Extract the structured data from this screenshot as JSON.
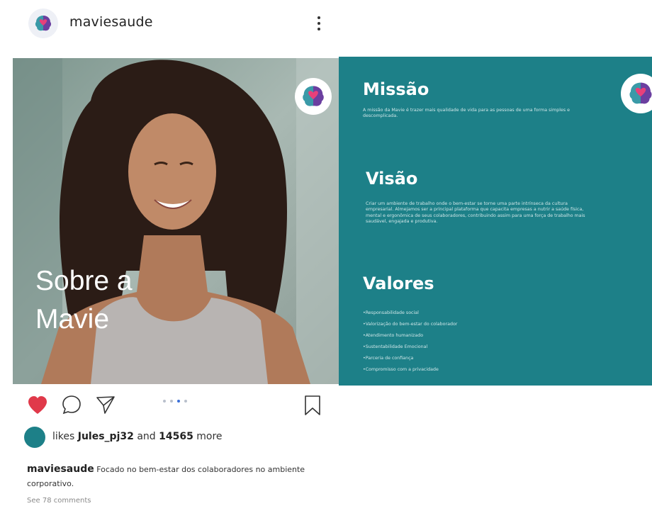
{
  "post": {
    "username": "maviesaude",
    "slide_photo": {
      "title_line1": "Sobre a",
      "title_line2": "Mavie"
    },
    "slide_info": {
      "mission_title": "Missão",
      "mission_text": "A missão da Mavie é trazer mais qualidade de vida para as pessoas de uma forma simples e descomplicada.",
      "vision_title": "Visão",
      "vision_text": "Criar um ambiente de trabalho onde o bem-estar se torne uma parte intrínseca da cultura empresarial. Almejamos ser a principal plataforma que capacita empresas a nutrir a saúde física, mental e ergonômica de seus colaboradores, contribuindo assim para uma força de trabalho mais saudável, engajada e produtiva.",
      "values_title": "Valores",
      "values": [
        "•Responsabilidade social",
        "•Valorização do bem-estar do colaborador",
        "•Atendimento humanizado",
        "•Sustentabilidade Emocional",
        "•Parceria de confiança",
        "•Compromisso com a privacidade"
      ]
    },
    "likes": {
      "prefix": "likes",
      "user": "Jules_pj32",
      "connector": "and",
      "count": "14565",
      "suffix": "more"
    },
    "caption": {
      "user": "maviesaude",
      "text": "Focado no bem-estar dos colaboradores no ambiente corporativo."
    },
    "comments_link": "See 78 comments"
  },
  "colors": {
    "teal": "#1d8088",
    "like_red": "#e0394a",
    "carousel_active": "#3b6fd8"
  },
  "icons": [
    "brain-logo-icon",
    "more-vertical-icon",
    "heart-icon",
    "comment-icon",
    "share-icon",
    "bookmark-icon"
  ]
}
